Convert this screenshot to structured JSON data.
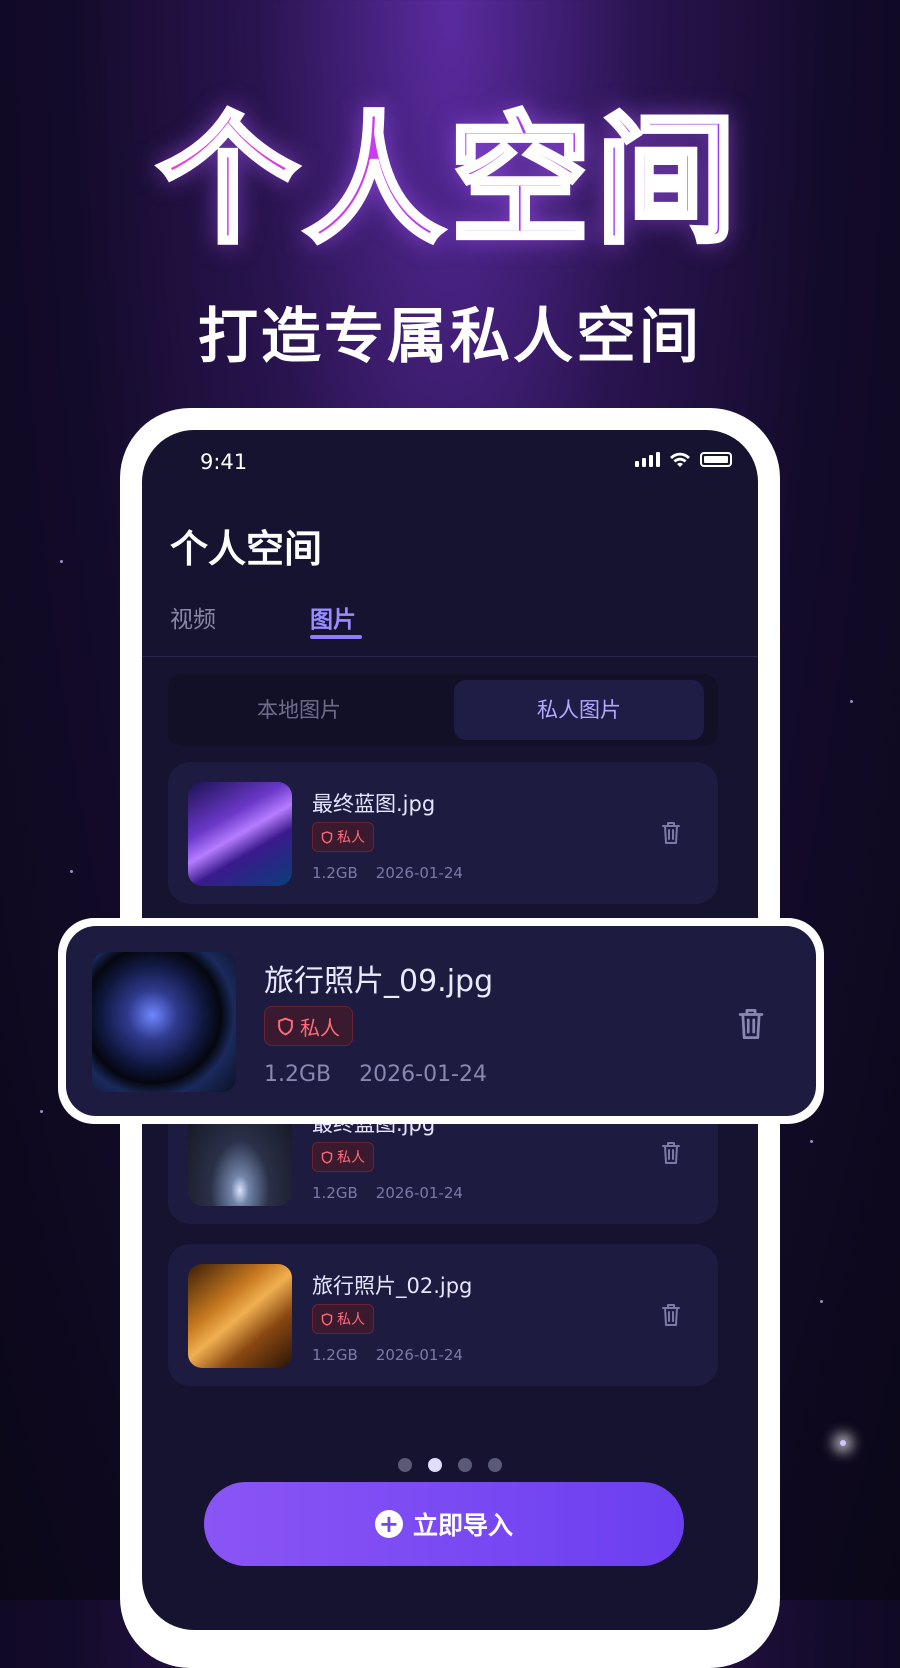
{
  "promo": {
    "title": "个人空间",
    "subtitle": "打造专属私人空间"
  },
  "status_bar": {
    "time": "9:41"
  },
  "app": {
    "title": "个人空间"
  },
  "tabs": [
    {
      "label": "视频"
    },
    {
      "label": "图片",
      "active": true
    }
  ],
  "segments": [
    {
      "label": "本地图片"
    },
    {
      "label": "私人图片",
      "active": true
    }
  ],
  "files": [
    {
      "name": "最终蓝图.jpg",
      "badge": "私人",
      "size": "1.2GB",
      "date": "2026-01-24"
    },
    {
      "name": "最终蓝图.jpg",
      "badge": "私人",
      "size": "1.2GB",
      "date": "2026-01-24"
    },
    {
      "name": "旅行照片_02.jpg",
      "badge": "私人",
      "size": "1.2GB",
      "date": "2026-01-24"
    }
  ],
  "highlighted_file": {
    "name": "旅行照片_09.jpg",
    "badge": "私人",
    "size": "1.2GB",
    "date": "2026-01-24"
  },
  "pager": {
    "total": 4,
    "active_index": 1
  },
  "import_button": {
    "label": "立即导入",
    "icon": "plus-circle-icon"
  },
  "colors": {
    "accent": "#8f7bff",
    "button": "#7446f0",
    "badge_text": "#ff6b7a",
    "background": "#15132f"
  }
}
